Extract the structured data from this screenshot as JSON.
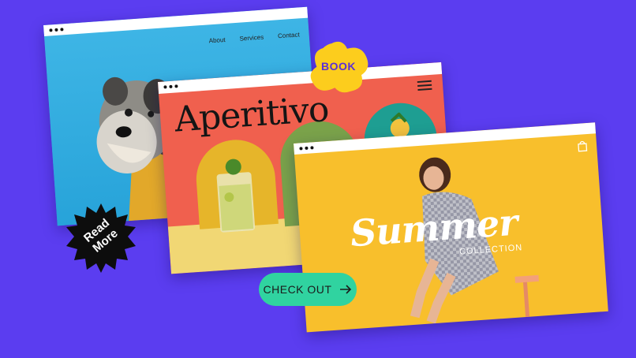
{
  "dog_site": {
    "nav": [
      "About",
      "Services",
      "Contact"
    ]
  },
  "aperitivo_site": {
    "title": "Aperitivo"
  },
  "summer_site": {
    "headline": "Summer",
    "subheadline": "COLLECTION"
  },
  "badges": {
    "book": "BOOK",
    "read_more": "Read More",
    "check_out": "CHECK OUT"
  },
  "colors": {
    "background": "#5b3df0",
    "dog_bg": "#3fb6e6",
    "aperitivo_bg": "#f0604e",
    "summer_bg": "#f8bf2c",
    "book_badge": "#fccd1d",
    "check_out": "#30d3a0"
  }
}
